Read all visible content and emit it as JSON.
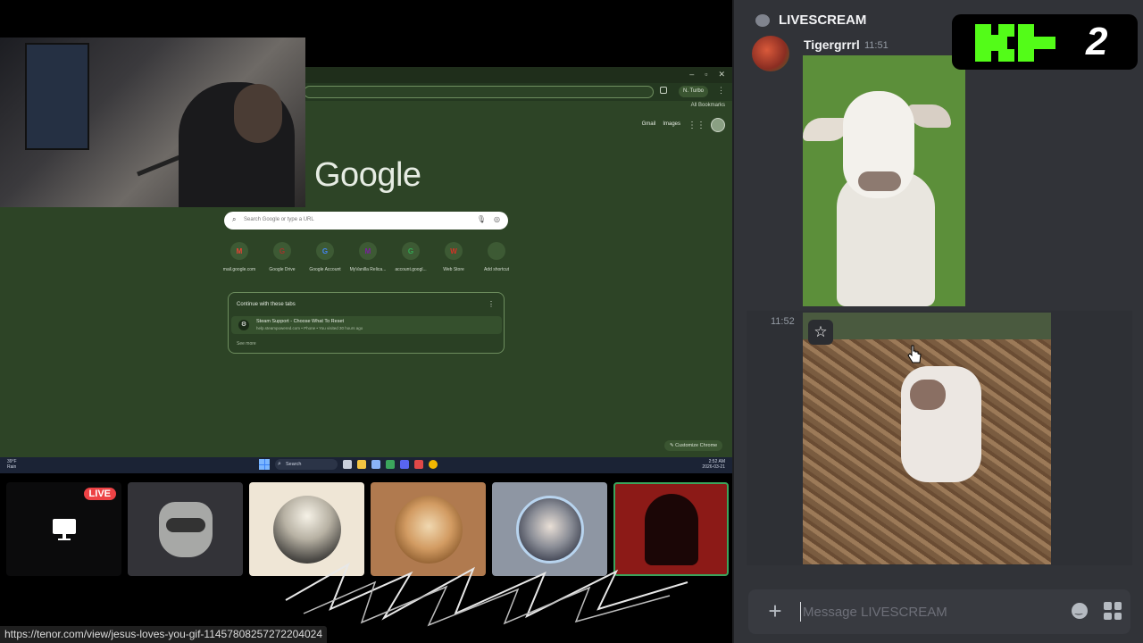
{
  "stream": {
    "browser": {
      "profile_label": "N. Turbo",
      "bookmarks_label": "All Bookmarks",
      "gmail_link": "Gmail",
      "images_link": "Images",
      "logo_text": "Google",
      "search_placeholder": "Search Google or type a URL",
      "shortcuts": [
        {
          "label": "mail.google.com",
          "initial": "M",
          "color": "#ea4335"
        },
        {
          "label": "Google Drive",
          "initial": "G",
          "color": "#a0342b"
        },
        {
          "label": "Google Account",
          "initial": "G",
          "color": "#4285f4"
        },
        {
          "label": "MyVanilla Relica...",
          "initial": "M",
          "color": "#7b1fa2"
        },
        {
          "label": "account.googl...",
          "initial": "G",
          "color": "#34a853"
        },
        {
          "label": "Web Store",
          "initial": "W",
          "color": "#d93025"
        },
        {
          "label": "Add shortcut",
          "initial": "+",
          "color": "#3d5a34"
        }
      ],
      "tabs_card": {
        "heading": "Continue with these tabs",
        "tab_title": "Steam Support - Choose What To Reset",
        "tab_subtitle": "help.steampowered.com • Phone • You visited 30 hours ago",
        "see_more": "See more"
      },
      "customize_label": "Customize Chrome"
    },
    "taskbar": {
      "left_text": "39°F\nRain",
      "search_label": "Search",
      "time": "2:52 AM",
      "date": "2026-03-21"
    },
    "participants": [
      {
        "name": "screen-share",
        "live_label": "LIVE"
      },
      {
        "name": "raccoon"
      },
      {
        "name": "moon"
      },
      {
        "name": "painting"
      },
      {
        "name": "person-frame"
      },
      {
        "name": "villain"
      }
    ],
    "status_url": "https://tenor.com/view/jesus-loves-you-gif-11457808257272204024"
  },
  "discord": {
    "channel_name": "LIVESCREAM",
    "messages": [
      {
        "author": "Tigergrrrl",
        "time": "11:51",
        "attachment": "goat-gif"
      },
      {
        "author": "",
        "time": "11:52",
        "attachment": "baby-goat-gif"
      }
    ],
    "composer": {
      "placeholder": "Message LIVESCREAM"
    }
  },
  "overlay": {
    "badge_number": "2",
    "brand_color": "#53fc18"
  }
}
